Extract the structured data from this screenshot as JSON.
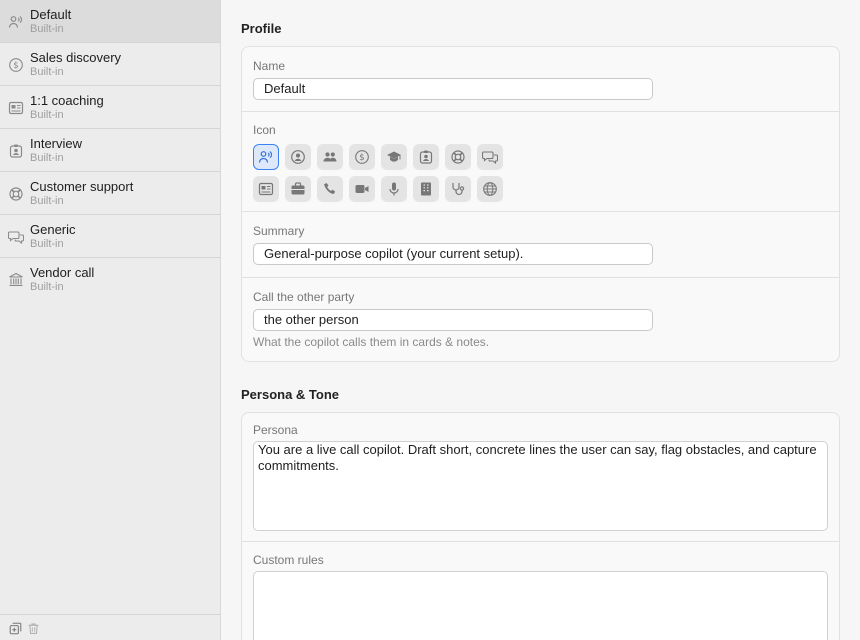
{
  "sidebar": {
    "items": [
      {
        "title": "Default",
        "subtitle": "Built-in",
        "icon": "person-wave-icon",
        "selected": true
      },
      {
        "title": "Sales discovery",
        "subtitle": "Built-in",
        "icon": "dollar-circle-icon"
      },
      {
        "title": "1:1 coaching",
        "subtitle": "Built-in",
        "icon": "id-card-icon"
      },
      {
        "title": "Interview",
        "subtitle": "Built-in",
        "icon": "badge-person-icon"
      },
      {
        "title": "Customer support",
        "subtitle": "Built-in",
        "icon": "lifebuoy-icon"
      },
      {
        "title": "Generic",
        "subtitle": "Built-in",
        "icon": "chat-bubbles-icon"
      },
      {
        "title": "Vendor call",
        "subtitle": "Built-in",
        "icon": "bank-icon"
      }
    ],
    "footer": {
      "add_icon": "add-copy-icon",
      "delete_icon": "trash-icon"
    }
  },
  "profile": {
    "section_title": "Profile",
    "name": {
      "label": "Name",
      "value": "Default"
    },
    "icon": {
      "label": "Icon",
      "options": [
        "person-wave-icon",
        "person-circle-icon",
        "people-icon",
        "dollar-circle-icon",
        "graduation-cap-icon",
        "badge-person-icon",
        "lifebuoy-icon",
        "chat-bubbles-icon",
        "id-card-icon",
        "briefcase-icon",
        "phone-icon",
        "video-icon",
        "microphone-icon",
        "building-icon",
        "stethoscope-icon",
        "globe-icon"
      ],
      "selected": "person-wave-icon"
    },
    "summary": {
      "label": "Summary",
      "value": "General-purpose copilot (your current setup)."
    },
    "call_other_party": {
      "label": "Call the other party",
      "value": "the other person",
      "hint": "What the copilot calls them in cards & notes."
    }
  },
  "persona_tone": {
    "section_title": "Persona & Tone",
    "persona": {
      "label": "Persona",
      "value": "You are a live call copilot. Draft short, concrete lines the user can say, flag obstacles, and capture commitments."
    },
    "custom_rules": {
      "label": "Custom rules",
      "value": ""
    }
  },
  "colors": {
    "accent": "#3b82f6",
    "sidebar_bg": "#ececec",
    "selected_row": "#dcdcdc"
  }
}
